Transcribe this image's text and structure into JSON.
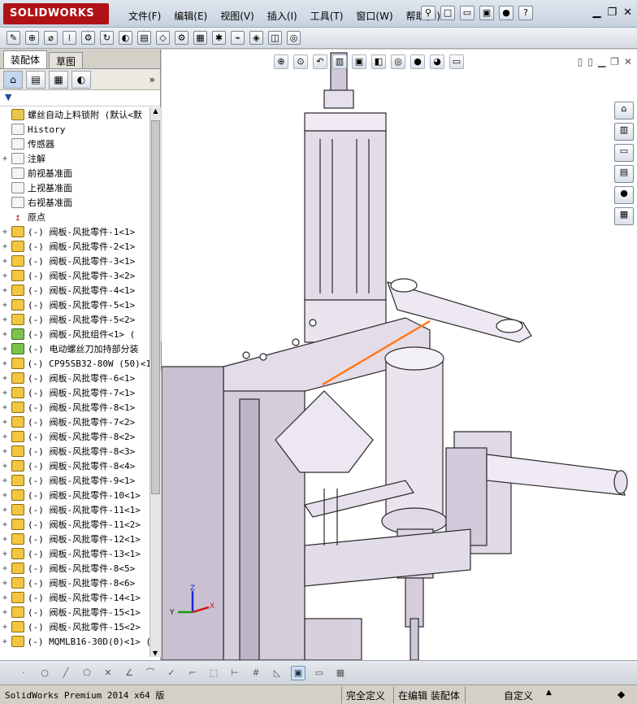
{
  "app": {
    "logo_text": "SOLIDWORKS"
  },
  "menu": [
    "文件(F)",
    "编辑(E)",
    "视图(V)",
    "插入(I)",
    "工具(T)",
    "窗口(W)",
    "帮助(H)"
  ],
  "panel_tabs": [
    "装配体",
    "草图"
  ],
  "tree": {
    "root": "螺丝自动上料锁附  (默认<默",
    "items": [
      {
        "label": "History",
        "icon": "history-icon",
        "expander": ""
      },
      {
        "label": "传感器",
        "icon": "sensor-icon",
        "expander": ""
      },
      {
        "label": "注解",
        "icon": "annotation-icon",
        "expander": "+"
      },
      {
        "label": "前视基准面",
        "icon": "plane-icon",
        "expander": ""
      },
      {
        "label": "上视基准面",
        "icon": "plane-icon",
        "expander": ""
      },
      {
        "label": "右视基准面",
        "icon": "plane-icon",
        "expander": ""
      },
      {
        "label": "原点",
        "icon": "origin-icon",
        "expander": ""
      },
      {
        "label": "(-) 阀板-风批零件-1<1>",
        "icon": "part-icon",
        "expander": "+"
      },
      {
        "label": "(-) 阀板-风批零件-2<1>",
        "icon": "part-icon",
        "expander": "+"
      },
      {
        "label": "(-) 阀板-风批零件-3<1>",
        "icon": "part-icon",
        "expander": "+"
      },
      {
        "label": "(-) 阀板-风批零件-3<2>",
        "icon": "part-icon",
        "expander": "+"
      },
      {
        "label": "(-) 阀板-风批零件-4<1>",
        "icon": "part-icon",
        "expander": "+"
      },
      {
        "label": "(-) 阀板-风批零件-5<1>",
        "icon": "part-icon",
        "expander": "+"
      },
      {
        "label": "(-) 阀板-风批零件-5<2>",
        "icon": "part-icon",
        "expander": "+"
      },
      {
        "label": "(-) 阀板-风批组件<1> (",
        "icon": "subassembly-icon",
        "expander": "+"
      },
      {
        "label": "(-) 电动螺丝刀加持部分装",
        "icon": "subassembly-icon",
        "expander": "+"
      },
      {
        "label": "(-) CP95SB32-80W (50)<1",
        "icon": "part-icon",
        "expander": "+"
      },
      {
        "label": "(-) 阀板-风批零件-6<1>",
        "icon": "part-icon",
        "expander": "+"
      },
      {
        "label": "(-) 阀板-风批零件-7<1>",
        "icon": "part-icon",
        "expander": "+"
      },
      {
        "label": "(-) 阀板-风批零件-8<1>",
        "icon": "part-icon",
        "expander": "+"
      },
      {
        "label": "(-) 阀板-风批零件-7<2>",
        "icon": "part-icon",
        "expander": "+"
      },
      {
        "label": "(-) 阀板-风批零件-8<2>",
        "icon": "part-icon",
        "expander": "+"
      },
      {
        "label": "(-) 阀板-风批零件-8<3>",
        "icon": "part-icon",
        "expander": "+"
      },
      {
        "label": "(-) 阀板-风批零件-8<4>",
        "icon": "part-icon",
        "expander": "+"
      },
      {
        "label": "(-) 阀板-风批零件-9<1>",
        "icon": "part-icon",
        "expander": "+"
      },
      {
        "label": "(-) 阀板-风批零件-10<1>",
        "icon": "part-icon",
        "expander": "+"
      },
      {
        "label": "(-) 阀板-风批零件-11<1>",
        "icon": "part-icon",
        "expander": "+"
      },
      {
        "label": "(-) 阀板-风批零件-11<2>",
        "icon": "part-icon",
        "expander": "+"
      },
      {
        "label": "(-) 阀板-风批零件-12<1>",
        "icon": "part-icon",
        "expander": "+"
      },
      {
        "label": "(-) 阀板-风批零件-13<1>",
        "icon": "part-icon",
        "expander": "+"
      },
      {
        "label": "(-) 阀板-风批零件-8<5>",
        "icon": "part-icon",
        "expander": "+"
      },
      {
        "label": "(-) 阀板-风批零件-8<6>",
        "icon": "part-icon",
        "expander": "+"
      },
      {
        "label": "(-) 阀板-风批零件-14<1>",
        "icon": "part-icon",
        "expander": "+"
      },
      {
        "label": "(-) 阀板-风批零件-15<1>",
        "icon": "part-icon",
        "expander": "+"
      },
      {
        "label": "(-) 阀板-风批零件-15<2>",
        "icon": "part-icon",
        "expander": "+"
      },
      {
        "label": "(-) MQMLB16-30D(0)<1> (",
        "icon": "part-icon",
        "expander": "+"
      }
    ]
  },
  "status": {
    "product": "SolidWorks Premium 2014 x64 版",
    "definition": "完全定义",
    "mode": "在编辑 装配体",
    "units": "自定义"
  },
  "colors": {
    "selection_edge": "#ff7a1a",
    "body_fill": "#d8d0de",
    "body_edge": "#2a2a2a",
    "logo_bg": "#b01218"
  },
  "triad": {
    "x": "X",
    "y": "Y",
    "z": "Z"
  }
}
